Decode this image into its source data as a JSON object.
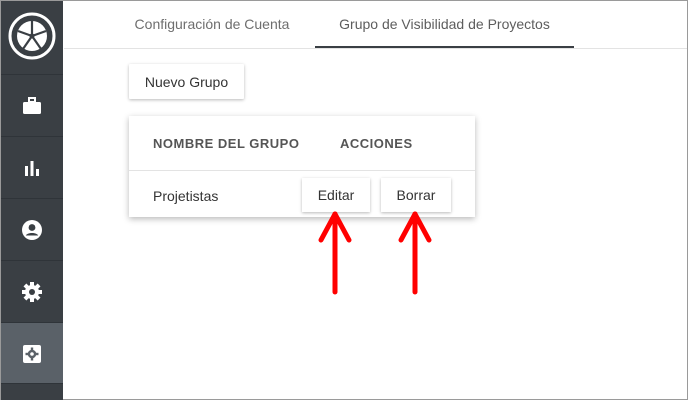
{
  "sidebar": {
    "logo": {
      "icon": "logo-wheel-icon"
    },
    "items": [
      {
        "icon": "briefcase-icon",
        "active": false
      },
      {
        "icon": "bar-chart-icon",
        "active": false
      },
      {
        "icon": "account-circle-icon",
        "active": false
      },
      {
        "icon": "gear-icon",
        "active": false
      },
      {
        "icon": "gear-box-icon",
        "active": true
      }
    ]
  },
  "tabs": [
    {
      "label": "Configuración de Cuenta",
      "active": false
    },
    {
      "label": "Grupo de Visibilidad de Proyectos",
      "active": true
    }
  ],
  "toolbar": {
    "new_group_label": "Nuevo Grupo"
  },
  "table": {
    "headers": [
      "NOMBRE DEL GRUPO",
      "ACCIONES"
    ],
    "rows": [
      {
        "name": "Projetistas",
        "edit_label": "Editar",
        "delete_label": "Borrar"
      }
    ]
  },
  "annotations": {
    "arrow_color": "#ff0000",
    "arrow_icon": "up-arrow-icon"
  },
  "colors": {
    "sidebar": "#3a3f44",
    "sidebar_active": "#5a6168",
    "tab_indicator": "#3a3f44"
  }
}
